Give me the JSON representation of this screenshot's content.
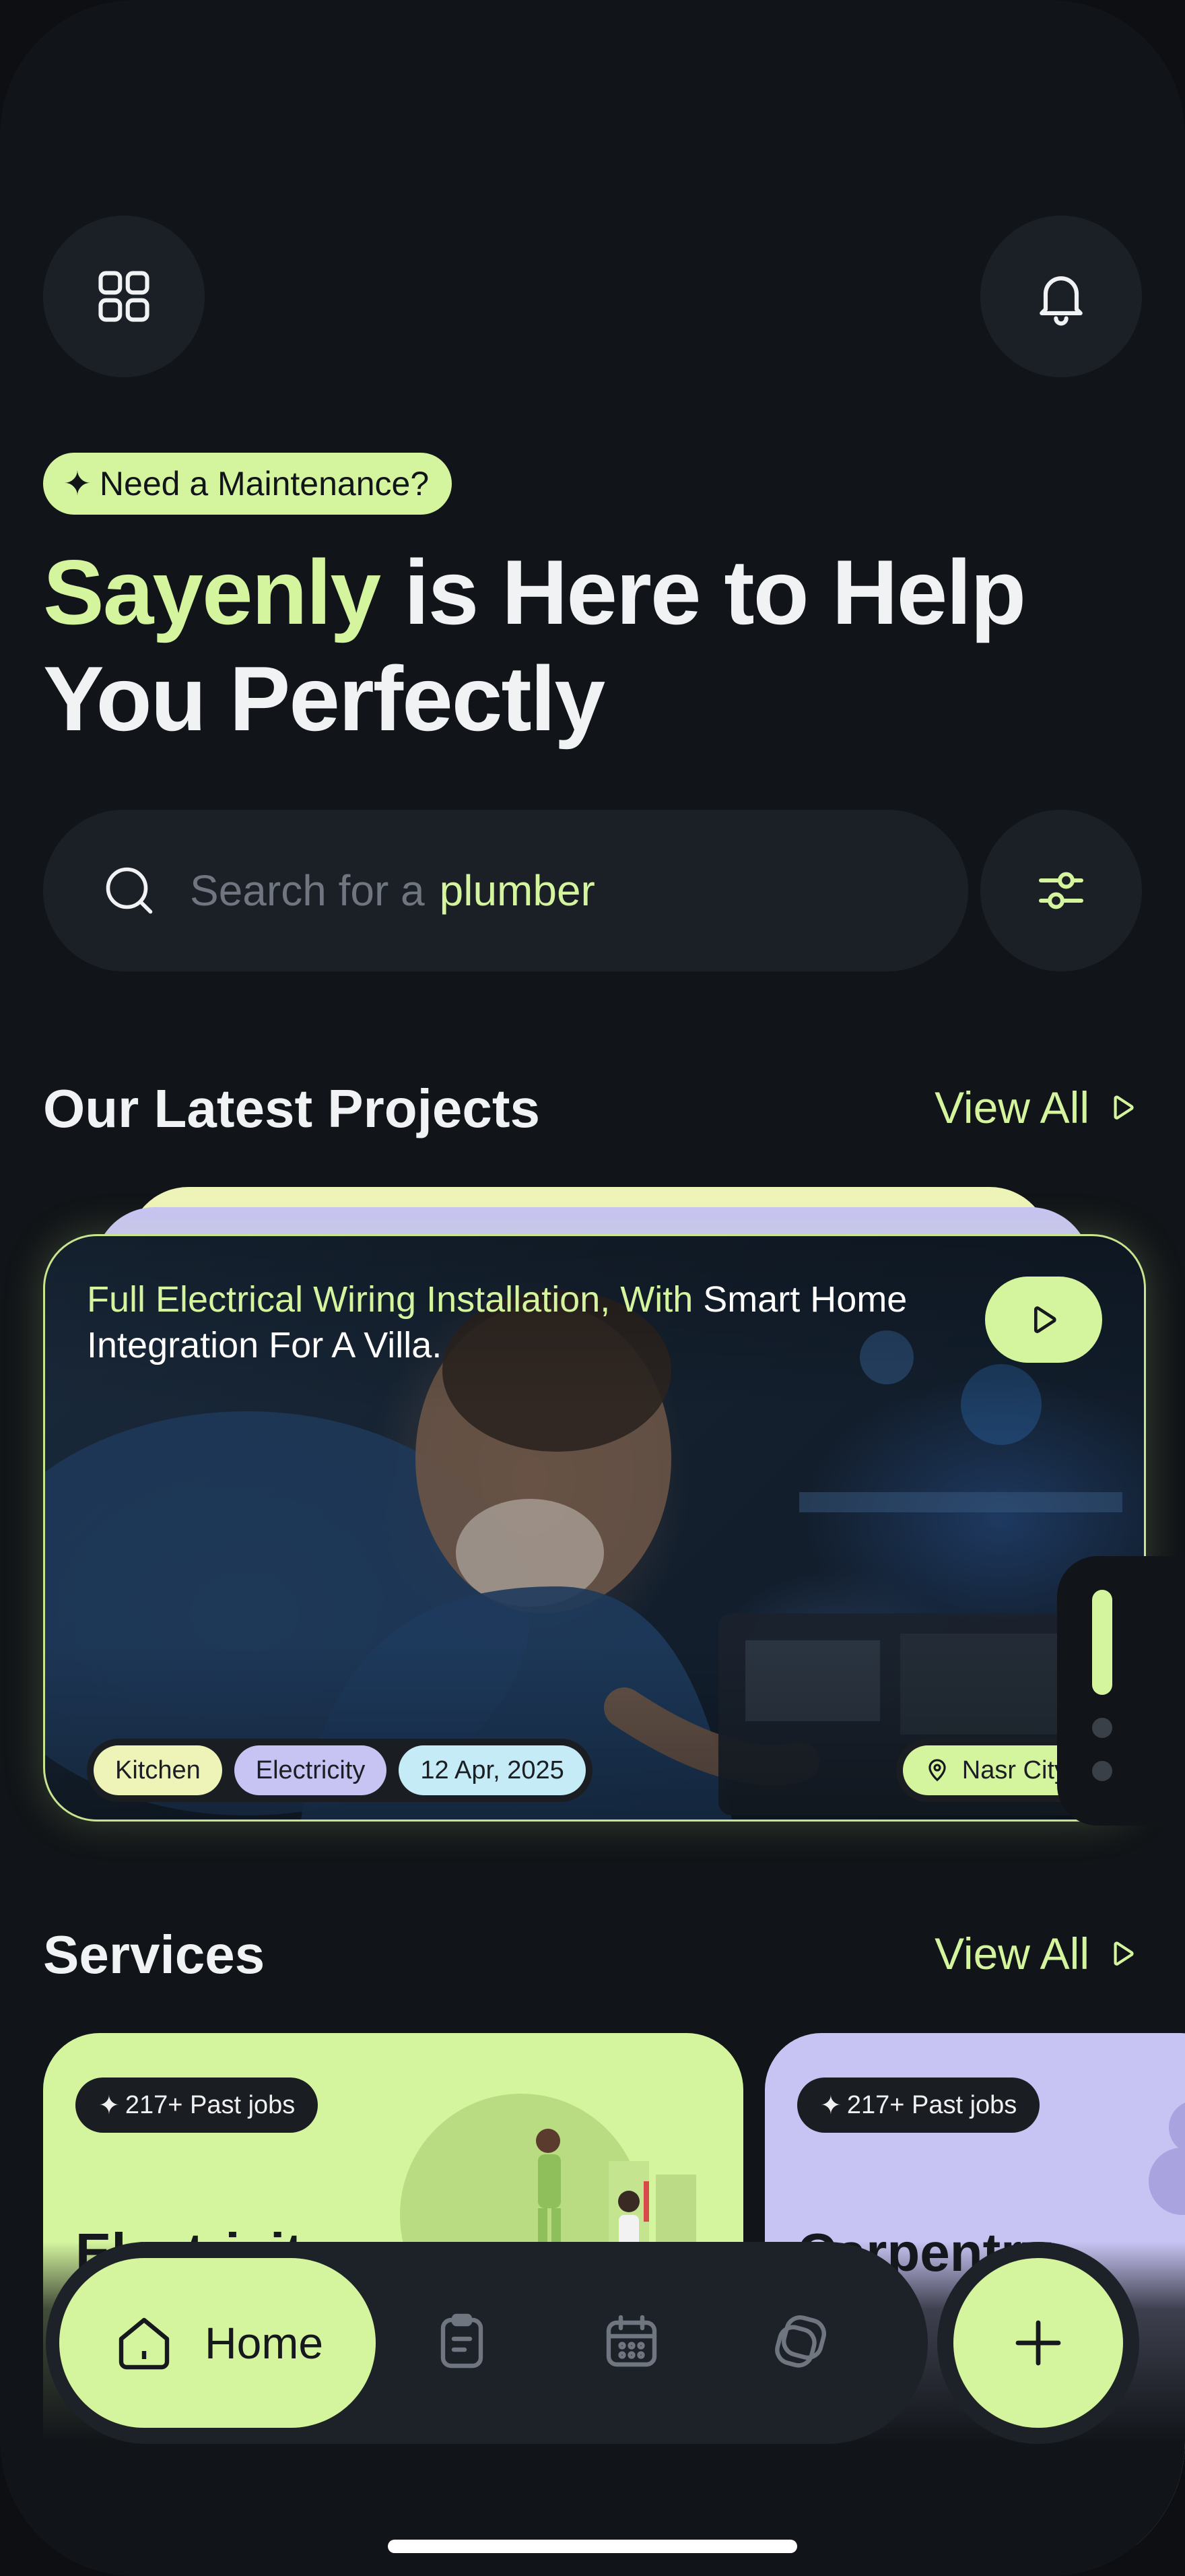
{
  "header": {
    "menu_icon": "grid-icon",
    "bell_icon": "bell-icon"
  },
  "hero": {
    "badge_icon": "✦",
    "badge": "Need a Maintenance?",
    "brand": "Sayenly",
    "headline_rest_1": " is Here to Help",
    "headline_line_2": "You Perfectly"
  },
  "search": {
    "placeholder": "Search for a",
    "keyword": "plumber",
    "filter_icon": "sliders-icon"
  },
  "projects": {
    "title": "Our Latest Projects",
    "view_all": "View All",
    "card": {
      "title_highlight": "Full Electrical Wiring Installation, With",
      "title_rest": " Smart Home Integration For A Villa.",
      "tags": [
        {
          "label": "Kitchen",
          "color": "#eef3b8"
        },
        {
          "label": "Electricity",
          "color": "#c7c3f2"
        },
        {
          "label": "12 Apr, 2025",
          "color": "#c4ebf6"
        }
      ],
      "location": "Nasr City"
    }
  },
  "services": {
    "title": "Services",
    "view_all": "View All",
    "items": [
      {
        "badge": "217+ Past jobs",
        "name": "Electricity",
        "color": "#d4f49e"
      },
      {
        "badge": "217+ Past jobs",
        "name": "Carpentry",
        "color": "#c7c3f2"
      }
    ]
  },
  "nav": {
    "home_label": "Home",
    "items": [
      "home-icon",
      "clipboard-icon",
      "calendar-icon",
      "layers-icon"
    ],
    "fab_icon": "plus-icon"
  },
  "colors": {
    "accent": "#d4f49e",
    "background": "#111418",
    "surface": "#1b2026"
  }
}
